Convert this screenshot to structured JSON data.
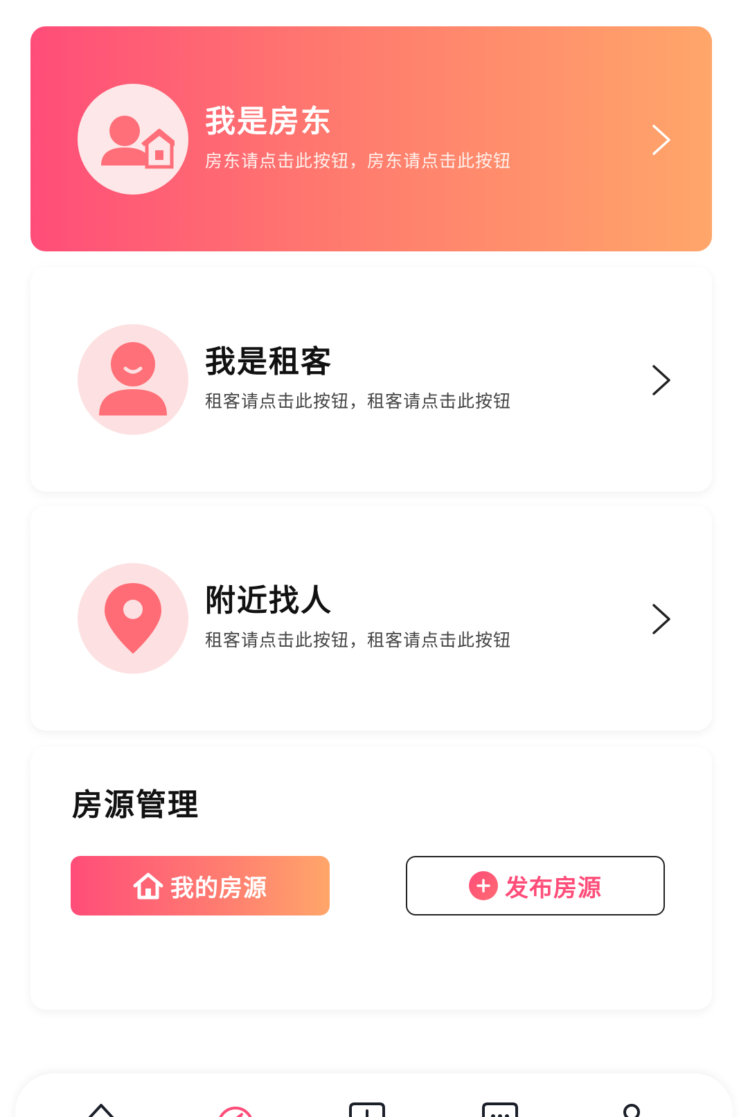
{
  "cards": {
    "landlord": {
      "title": "我是房东",
      "subtitle": "房东请点击此按钮，房东请点击此按钮"
    },
    "tenant": {
      "title": "我是租客",
      "subtitle": "租客请点击此按钮，租客请点击此按钮"
    },
    "nearby": {
      "title": "附近找人",
      "subtitle": "租客请点击此按钮，租客请点击此按钮"
    }
  },
  "management": {
    "title": "房源管理",
    "my_listings_label": "我的房源",
    "publish_label": "发布房源"
  },
  "tabbar": {
    "icons": [
      "home-icon",
      "compass-icon",
      "add-square-icon",
      "message-icon",
      "profile-icon"
    ]
  },
  "colors": {
    "gradient_start": "#ff4d79",
    "gradient_end": "#ffa66a",
    "accent": "#ff4d79"
  }
}
